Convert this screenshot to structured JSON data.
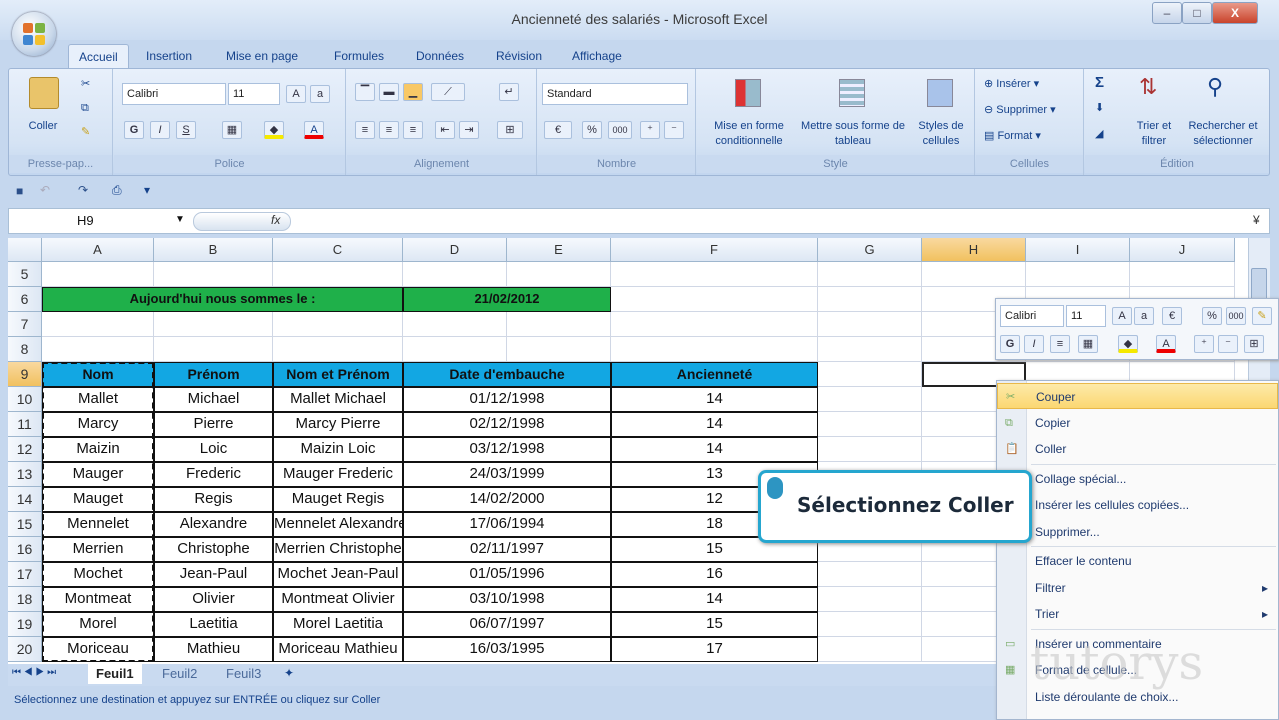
{
  "window": {
    "title": "Ancienneté des salariés - Microsoft Excel",
    "minimize": "–",
    "maximize": "□",
    "close": "X"
  },
  "tabs": [
    "Accueil",
    "Insertion",
    "Mise en page",
    "Formules",
    "Données",
    "Révision",
    "Affichage"
  ],
  "ribbon": {
    "clipboard": {
      "paste": "Coller",
      "label": "Presse-pap..."
    },
    "font": {
      "name": "Calibri",
      "size": "11",
      "label": "Police",
      "bold": "G",
      "italic": "I",
      "underline": "S"
    },
    "alignment": {
      "label": "Alignement"
    },
    "number": {
      "format": "Standard",
      "percent": "%",
      "thousands": "000",
      "label": "Nombre"
    },
    "style": {
      "conditional": "Mise en forme conditionnelle",
      "table": "Mettre sous forme de tableau",
      "cellstyles": "Styles de cellules",
      "label": "Style"
    },
    "cells": {
      "insert": "Insérer",
      "delete": "Supprimer",
      "format": "Format",
      "label": "Cellules"
    },
    "editing": {
      "sort": "Trier et filtrer",
      "find": "Rechercher et sélectionner",
      "label": "Édition",
      "sum": "Σ"
    }
  },
  "formula_bar": {
    "name_box": "H9",
    "fx": "fx",
    "value": ""
  },
  "columns": [
    "A",
    "B",
    "C",
    "D",
    "E",
    "F",
    "G",
    "H",
    "I",
    "J"
  ],
  "rows": [
    "5",
    "6",
    "7",
    "8",
    "9",
    "10",
    "11",
    "12",
    "13",
    "14",
    "15",
    "16",
    "17",
    "18",
    "19",
    "20"
  ],
  "sheet": {
    "today_label": "Aujourd'hui nous sommes le :",
    "today_value": "21/02/2012",
    "headers": [
      "Nom",
      "Prénom",
      "Nom et Prénom",
      "Date d'embauche",
      "Ancienneté"
    ],
    "data": [
      [
        "Mallet",
        "Michael",
        "Mallet Michael",
        "01/12/1998",
        "14"
      ],
      [
        "Marcy",
        "Pierre",
        "Marcy Pierre",
        "02/12/1998",
        "14"
      ],
      [
        "Maizin",
        "Loic",
        "Maizin Loic",
        "03/12/1998",
        "14"
      ],
      [
        "Mauger",
        "Frederic",
        "Mauger Frederic",
        "24/03/1999",
        "13"
      ],
      [
        "Mauget",
        "Regis",
        "Mauget Regis",
        "14/02/2000",
        "12"
      ],
      [
        "Mennelet",
        "Alexandre",
        "Mennelet Alexandre",
        "17/06/1994",
        "18"
      ],
      [
        "Merrien",
        "Christophe",
        "Merrien Christophe",
        "02/11/1997",
        "15"
      ],
      [
        "Mochet",
        "Jean-Paul",
        "Mochet Jean-Paul",
        "01/05/1996",
        "16"
      ],
      [
        "Montmeat",
        "Olivier",
        "Montmeat Olivier",
        "03/10/1998",
        "14"
      ],
      [
        "Morel",
        "Laetitia",
        "Morel Laetitia",
        "06/07/1997",
        "15"
      ],
      [
        "Moriceau",
        "Mathieu",
        "Moriceau Mathieu",
        "16/03/1995",
        "17"
      ]
    ]
  },
  "sheet_tabs": [
    "Feuil1",
    "Feuil2",
    "Feuil3"
  ],
  "status": "Sélectionnez une destination et appuyez sur ENTRÉE ou cliquez sur Coller",
  "mini_toolbar": {
    "font": "Calibri",
    "size": "11",
    "percent": "%",
    "thousands": "000"
  },
  "context_menu": [
    "Couper",
    "Copier",
    "Coller",
    "Collage spécial...",
    "Insérer les cellules copiées...",
    "Supprimer...",
    "Effacer le contenu",
    "Filtrer",
    "Trier",
    "Insérer un commentaire",
    "Format de cellule...",
    "Liste déroulante de choix..."
  ],
  "callout": "Sélectionnez Coller",
  "watermark": "tutorys",
  "colors": {
    "header_blue": "#12a7e3",
    "green": "#1fb04a",
    "accent": "#25a6cf"
  }
}
